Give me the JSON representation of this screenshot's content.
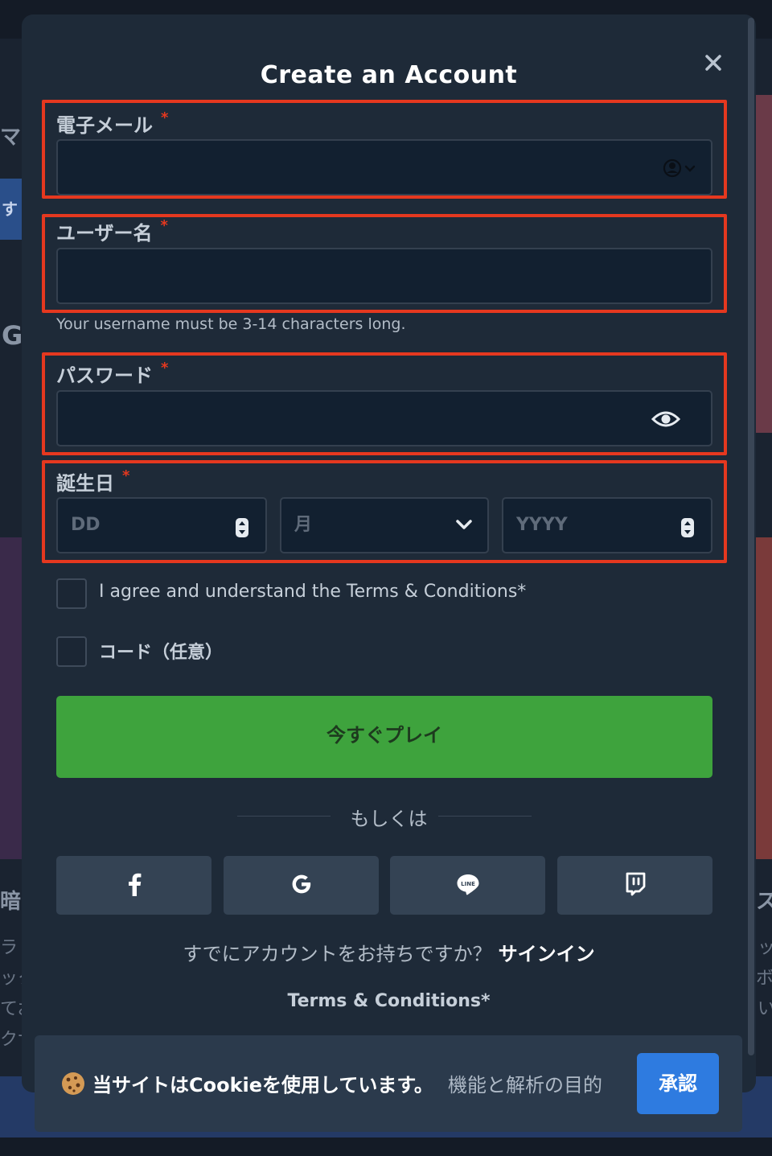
{
  "background": {
    "fragments": [
      "マ-",
      "す",
      "G",
      "暗",
      "ラ",
      "ック",
      "てお",
      "クサ",
      "ス",
      "ッ",
      "ボ",
      "い"
    ]
  },
  "modal": {
    "title": "Create an Account",
    "close_icon": "close-icon"
  },
  "form": {
    "email": {
      "label": "電子メール",
      "required_mark": "*",
      "value": "",
      "icon": "contact-dropdown-icon"
    },
    "username": {
      "label": "ユーザー名",
      "required_mark": "*",
      "value": "",
      "hint": "Your username must be 3-14 characters long."
    },
    "password": {
      "label": "パスワード",
      "required_mark": "*",
      "value": "",
      "icon": "eye-icon"
    },
    "birthday": {
      "label": "誕生日",
      "required_mark": "*",
      "day_placeholder": "DD",
      "month_placeholder": "月",
      "year_placeholder": "YYYY"
    },
    "terms_checkbox_label": "I agree and understand the Terms & Conditions*",
    "code_checkbox_label": "コード（任意）",
    "submit_label": "今すぐプレイ"
  },
  "divider": {
    "text": "もしくは"
  },
  "social_buttons": [
    "facebook-icon",
    "google-icon",
    "line-icon",
    "twitch-icon"
  ],
  "signin": {
    "prompt": "すでにアカウントをお持ちですか？",
    "link": "サインイン"
  },
  "terms_link": "Terms & Conditions*",
  "cookie": {
    "text": "当サイトはCookieを使用しています。",
    "link": "機能と解析の目的",
    "accept_label": "承認"
  },
  "colors": {
    "highlight": "#e5381f",
    "play_button": "#3ea33d",
    "accept_button": "#2e7be0",
    "modal_bg": "#1e2a38"
  }
}
